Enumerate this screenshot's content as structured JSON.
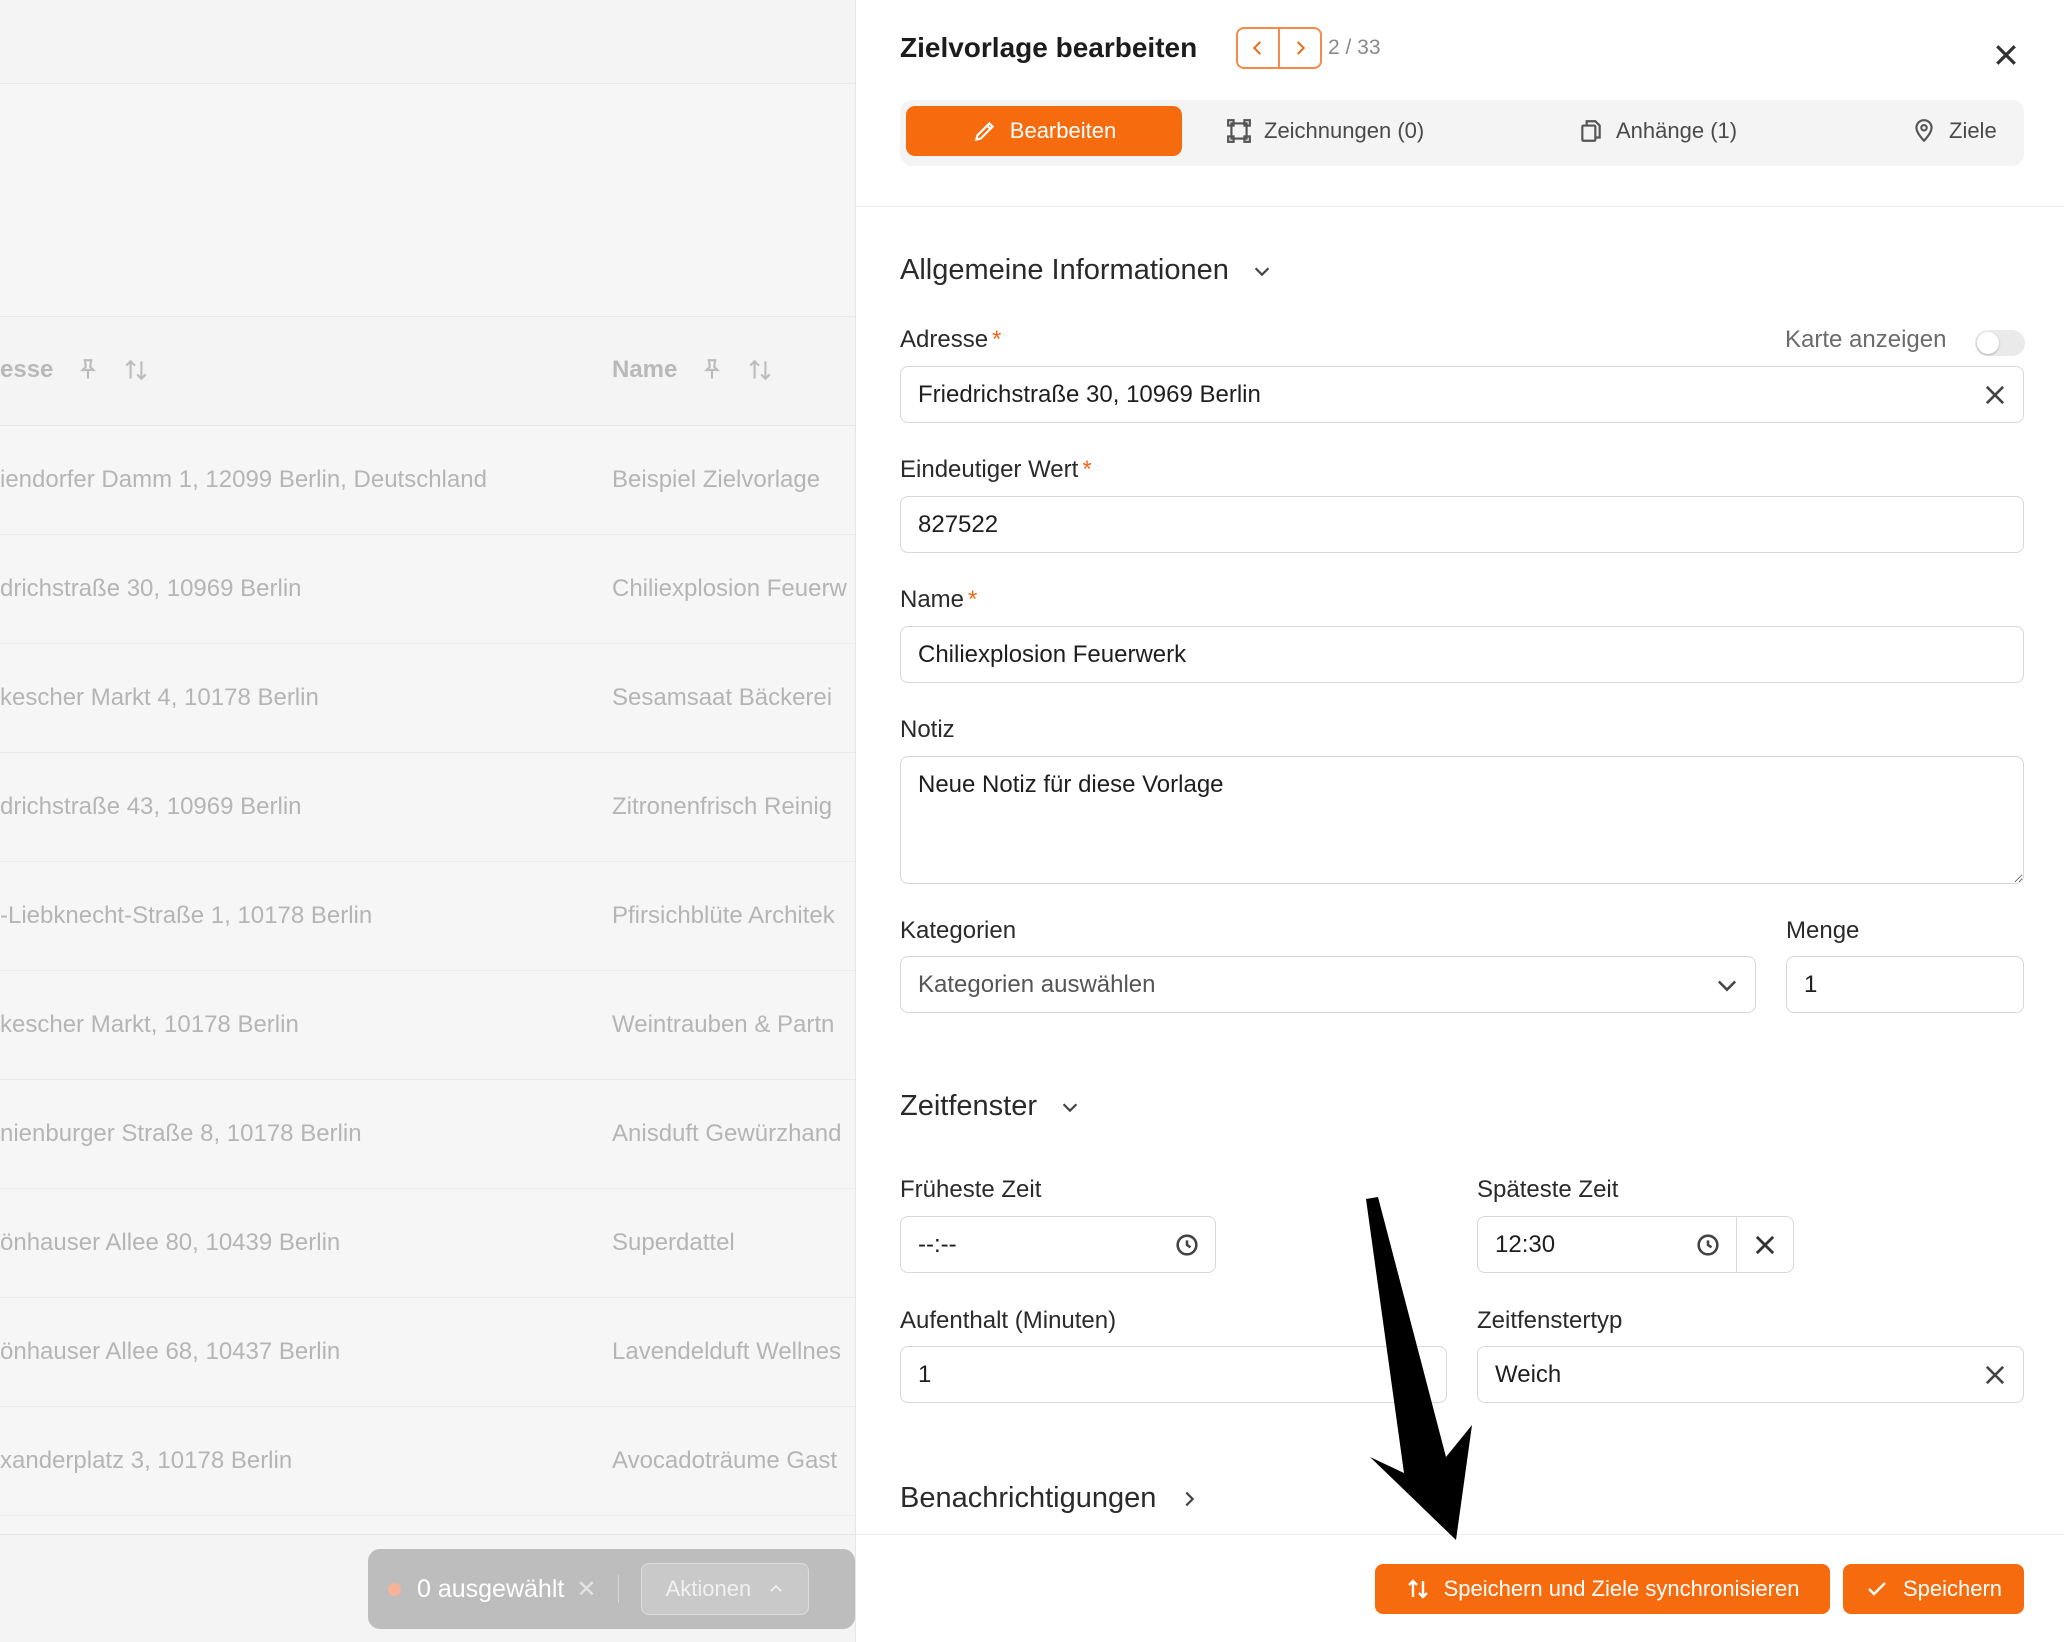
{
  "background": {
    "columns": {
      "address": "esse",
      "name": "Name"
    },
    "rows": [
      {
        "address": "iendorfer Damm 1, 12099 Berlin, Deutschland",
        "name": "Beispiel Zielvorlage"
      },
      {
        "address": "drichstraße 30, 10969 Berlin",
        "name": "Chiliexplosion Feuerw"
      },
      {
        "address": "kescher Markt 4, 10178 Berlin",
        "name": "Sesamsaat Bäckerei"
      },
      {
        "address": "drichstraße 43, 10969 Berlin",
        "name": "Zitronenfrisch Reinig"
      },
      {
        "address": "-Liebknecht-Straße 1, 10178 Berlin",
        "name": "Pfirsichblüte Architek"
      },
      {
        "address": "kescher Markt, 10178 Berlin",
        "name": "Weintrauben & Partn"
      },
      {
        "address": "nienburger Straße 8, 10178 Berlin",
        "name": "Anisduft Gewürzhand"
      },
      {
        "address": "önhauser Allee 80, 10439 Berlin",
        "name": "Superdattel"
      },
      {
        "address": "önhauser Allee 68, 10437 Berlin",
        "name": "Lavendelduft Wellnes"
      },
      {
        "address": "xanderplatz 3, 10178 Berlin",
        "name": "Avocadoträume Gast"
      }
    ],
    "selection": {
      "count_label": "0 ausgewählt",
      "actions_label": "Aktionen"
    }
  },
  "panel": {
    "title": "Zielvorlage bearbeiten",
    "counter": "2 / 33",
    "tabs": [
      {
        "label": "Bearbeiten",
        "icon": "pencil-icon"
      },
      {
        "label": "Zeichnungen (0)",
        "icon": "shape-icon"
      },
      {
        "label": "Anhänge (1)",
        "icon": "copy-icon"
      },
      {
        "label": "Ziele",
        "icon": "map-pin-icon"
      }
    ],
    "general": {
      "title": "Allgemeine Informationen",
      "address_label": "Adresse",
      "address_value": "Friedrichstraße 30, 10969 Berlin",
      "map_toggle_label": "Karte anzeigen",
      "unique_label": "Eindeutiger Wert",
      "unique_value": "827522",
      "name_label": "Name",
      "name_value": "Chiliexplosion Feuerwerk",
      "note_label": "Notiz",
      "note_value": "Neue Notiz für diese Vorlage",
      "categories_label": "Kategorien",
      "categories_placeholder": "Kategorien auswählen",
      "quantity_label": "Menge",
      "quantity_value": "1",
      "required_mark": "*"
    },
    "timewindow": {
      "title": "Zeitfenster",
      "earliest_label": "Früheste Zeit",
      "earliest_value": "--:--",
      "latest_label": "Späteste Zeit",
      "latest_value": "12:30",
      "stay_label": "Aufenthalt (Minuten)",
      "stay_value": "1",
      "type_label": "Zeitfenstertyp",
      "type_value": "Weich"
    },
    "notifications": {
      "title": "Benachrichtigungen"
    },
    "footer": {
      "sync_button": "Speichern und Ziele synchronisieren",
      "save_button": "Speichern"
    }
  },
  "colors": {
    "accent": "#f66b0e",
    "required": "#f2681a",
    "annotation_arrow": "#000000"
  }
}
